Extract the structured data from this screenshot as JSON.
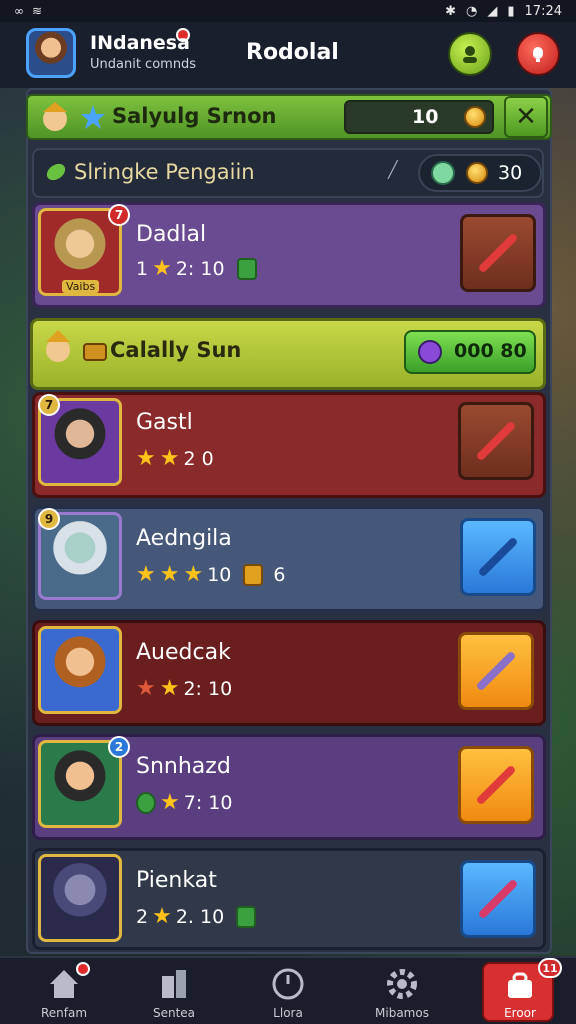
{
  "status_bar": {
    "time": "17:24"
  },
  "header": {
    "user_name": "INdanesa",
    "user_subtitle": "Undanit comnds",
    "title": "Rodolal"
  },
  "season": {
    "title": "Salyulg Srnon",
    "value": "10"
  },
  "subheader": {
    "title": "Slringke Pengaiin",
    "value": "30"
  },
  "event": {
    "title": "Calally Sun",
    "value": "000 80"
  },
  "cards": [
    {
      "name": "Dadlal",
      "stat_a": "1",
      "stat_b": "2: 10",
      "level": "7",
      "portrait_label": "Vaibs"
    },
    {
      "name": "Gastl",
      "stat_a": "",
      "stat_b": "2  0",
      "level": "7"
    },
    {
      "name": "Aedngila",
      "stat_a": "",
      "stat_b": "10",
      "stat_c": "6",
      "level": "9"
    },
    {
      "name": "Auedcak",
      "stat_a": "",
      "stat_b": "2: 10",
      "level": ""
    },
    {
      "name": "Snnhazd",
      "stat_a": "",
      "stat_b": "7: 10",
      "level": "2"
    },
    {
      "name": "Pienkat",
      "stat_a": "2",
      "stat_b": "2. 10",
      "level": ""
    }
  ],
  "bottom_nav": [
    {
      "label": "Renfam",
      "icon": "home-icon"
    },
    {
      "label": "Sentea",
      "icon": "building-icon"
    },
    {
      "label": "Llora",
      "icon": "clock-icon"
    },
    {
      "label": "Mibamos",
      "icon": "gear-icon"
    },
    {
      "label": "Eroor",
      "icon": "shop-icon",
      "badge": "11"
    }
  ],
  "colors": {
    "accent_green": "#7ec23e",
    "accent_red": "#d83030",
    "star": "#ffc21a"
  }
}
